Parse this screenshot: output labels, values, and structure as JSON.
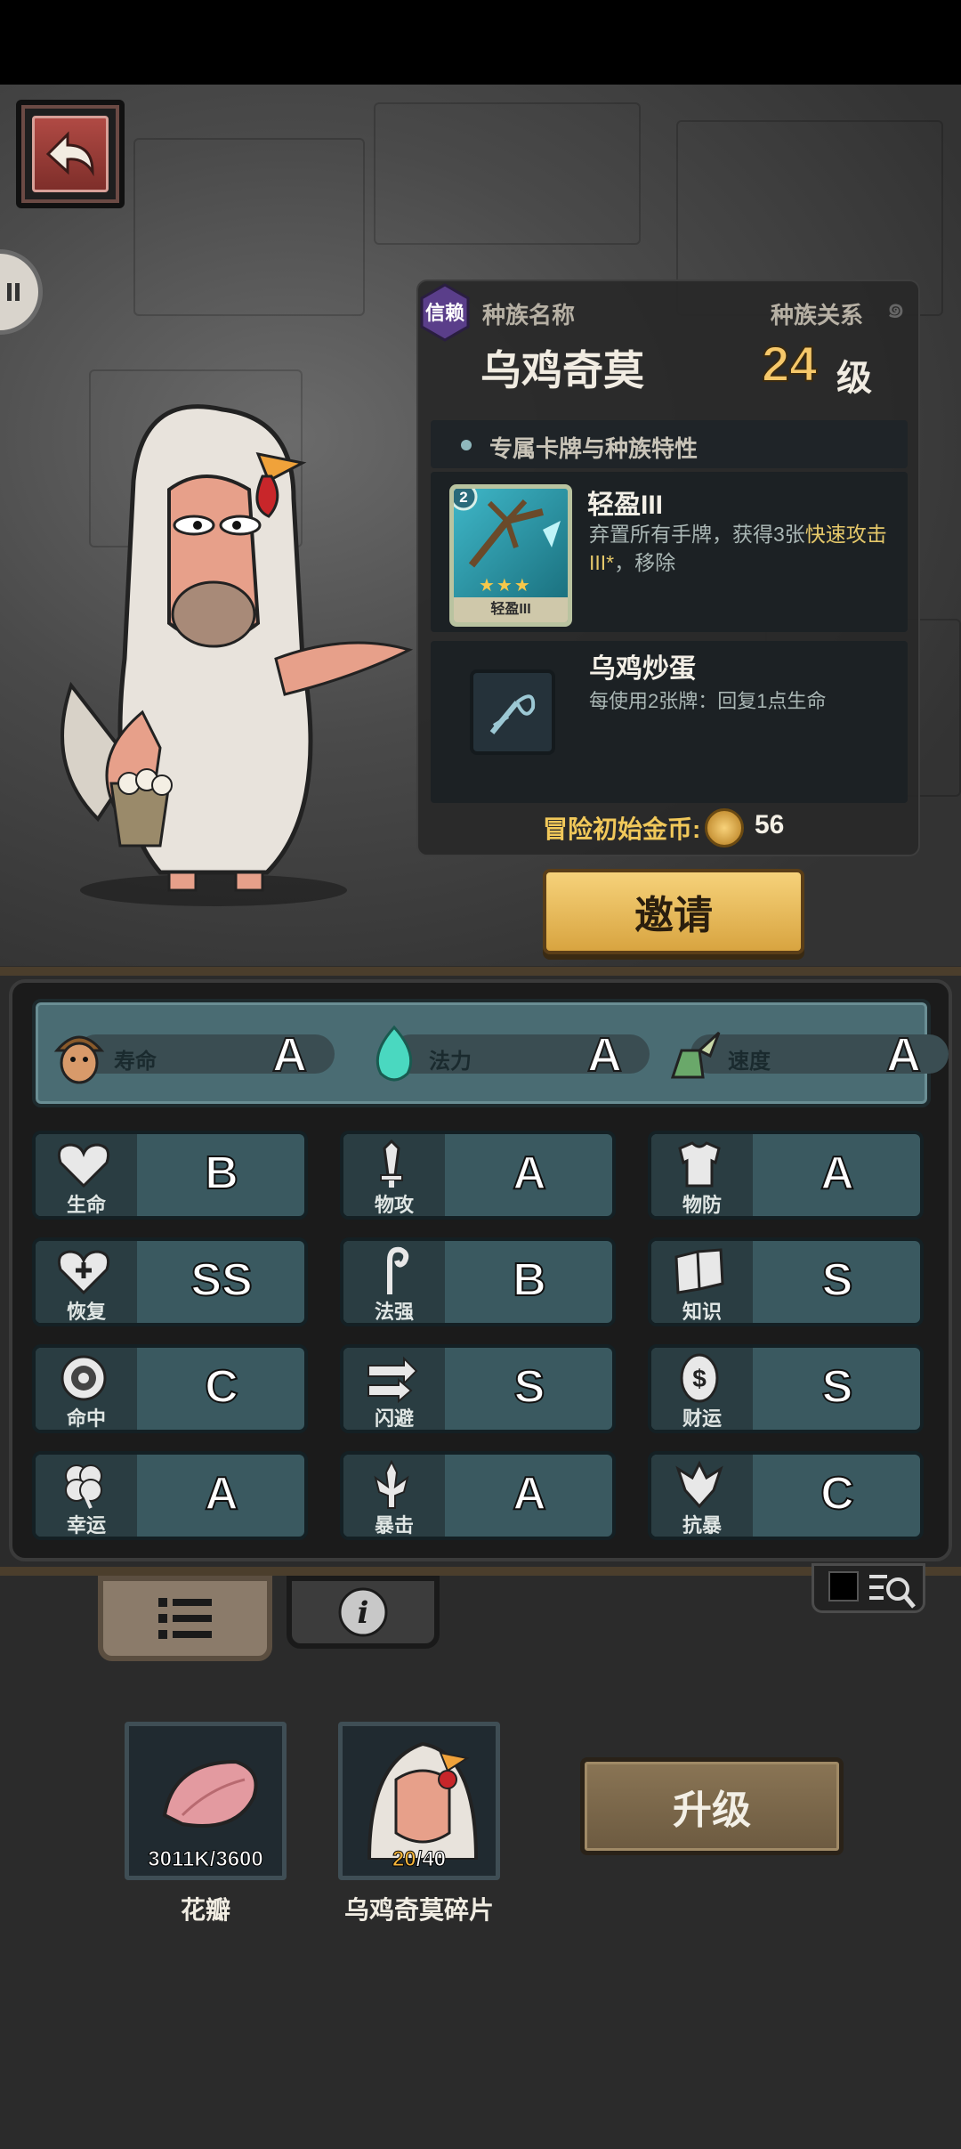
{
  "race": {
    "trust_badge": "信赖",
    "name_label": "种族名称",
    "relation_label": "种族关系",
    "name": "乌鸡奇莫",
    "level": "24",
    "level_unit": "级"
  },
  "section": {
    "title": "专属卡牌与种族特性"
  },
  "card": {
    "cost": "2",
    "ribbon": "轻盈III",
    "title": "轻盈III",
    "desc_plain": "弃置所有手牌，获得3张",
    "desc_highlight": "快速攻击III*",
    "desc_tail": "，移除",
    "stars": "★★★"
  },
  "trait": {
    "title": "乌鸡炒蛋",
    "desc": "每使用2张牌：回复1点生命"
  },
  "gold": {
    "label": "冒险初始金币:",
    "value": "56"
  },
  "invite_label": "邀请",
  "summary": [
    {
      "label": "寿命",
      "grade": "A",
      "icon": "acorn-character-icon"
    },
    {
      "label": "法力",
      "grade": "A",
      "icon": "mana-flame-icon"
    },
    {
      "label": "速度",
      "grade": "A",
      "icon": "winged-boot-icon"
    }
  ],
  "stats": [
    {
      "label": "生命",
      "grade": "B",
      "icon": "heart-icon"
    },
    {
      "label": "物攻",
      "grade": "A",
      "icon": "sword-icon"
    },
    {
      "label": "物防",
      "grade": "A",
      "icon": "armor-icon"
    },
    {
      "label": "恢复",
      "grade": "SS",
      "icon": "heart-plus-icon"
    },
    {
      "label": "法强",
      "grade": "B",
      "icon": "staff-icon"
    },
    {
      "label": "知识",
      "grade": "S",
      "icon": "book-icon"
    },
    {
      "label": "命中",
      "grade": "C",
      "icon": "target-icon"
    },
    {
      "label": "闪避",
      "grade": "S",
      "icon": "dodge-arrows-icon"
    },
    {
      "label": "财运",
      "grade": "S",
      "icon": "coin-icon"
    },
    {
      "label": "幸运",
      "grade": "A",
      "icon": "clover-icon"
    },
    {
      "label": "暴击",
      "grade": "A",
      "icon": "critical-icon"
    },
    {
      "label": "抗暴",
      "grade": "C",
      "icon": "shield-burst-icon"
    }
  ],
  "items": [
    {
      "name": "花瓣",
      "count_current": "3011K",
      "count_total": "/3600",
      "icon": "petal-icon"
    },
    {
      "name": "乌鸡奇莫碎片",
      "count_current": "20",
      "count_total": "/40",
      "icon": "chicken-portrait-icon"
    }
  ],
  "upgrade_label": "升级",
  "colors": {
    "accent_gold": "#f1c85a",
    "stat_tile": "#3a5960",
    "panel": "#282828"
  }
}
